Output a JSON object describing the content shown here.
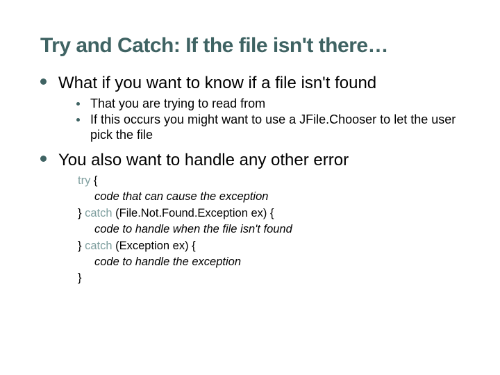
{
  "title": "Try and Catch: If the file isn't there…",
  "bullets": {
    "b0": {
      "text": "What if you want to know if a file isn't found",
      "sub": {
        "s0": "That you are trying to read from",
        "s1": "If this occurs you might want to use a JFile.Chooser to let the user pick the file"
      }
    },
    "b1": {
      "text": "You also want to handle any other error"
    }
  },
  "code": {
    "kw_try": "try",
    "brace_open": " {",
    "line_cause": "code that can cause the exception",
    "close1_pre": "} ",
    "kw_catch1": "catch",
    "catch1_rest": " (File.Not.Found.Exception ex) {",
    "line_notfound": "code to handle when the file isn't found",
    "close2_pre": "} ",
    "kw_catch2": "catch",
    "catch2_rest": " (Exception ex) {",
    "line_handle": "code to handle the exception",
    "brace_close": "}"
  }
}
